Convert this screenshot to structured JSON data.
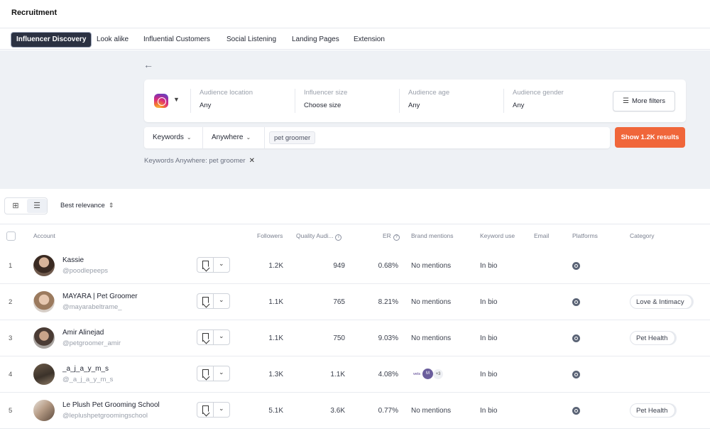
{
  "app": {
    "title": "Recruitment"
  },
  "tabs": [
    {
      "label": "Influencer Discovery",
      "active": true
    },
    {
      "label": "Look alike"
    },
    {
      "label": "Influential Customers"
    },
    {
      "label": "Social Listening"
    },
    {
      "label": "Landing Pages"
    },
    {
      "label": "Extension"
    }
  ],
  "search": {
    "platform_icon": "instagram-icon",
    "filters": [
      {
        "label": "Audience location",
        "value": "Any"
      },
      {
        "label": "Influencer size",
        "value": "Choose size"
      },
      {
        "label": "Audience age",
        "value": "Any"
      },
      {
        "label": "Audience gender",
        "value": "Any"
      }
    ],
    "more_filters_label": "More filters",
    "keyword_type": "Keywords",
    "keyword_scope": "Anywhere",
    "keyword_chip": "pet groomer",
    "show_results_label": "Show 1.2K results",
    "applied_filter": "Keywords Anywhere: pet groomer",
    "accent_color": "#f0663a"
  },
  "toolbar": {
    "sort_label": "Best relevance"
  },
  "table": {
    "columns": {
      "account": "Account",
      "followers": "Followers",
      "quality": "Quality Audi...",
      "er": "ER",
      "brand_mentions": "Brand mentions",
      "keyword_use": "Keyword use",
      "email": "Email",
      "platforms": "Platforms",
      "category": "Category"
    },
    "rows": [
      {
        "rank": "1",
        "name": "Kassie",
        "handle": "@poodlepeeps",
        "followers": "1.2K",
        "quality": "949",
        "er": "0.68%",
        "mentions": "No mentions",
        "keyword_use": "In bio",
        "category": ""
      },
      {
        "rank": "2",
        "name": "MAYARA | Pet Groomer",
        "handle": "@mayarabeltrame_",
        "followers": "1.1K",
        "quality": "765",
        "er": "8.21%",
        "mentions": "No mentions",
        "keyword_use": "In bio",
        "category": "Love & Intimacy"
      },
      {
        "rank": "3",
        "name": "Amir Alinejad",
        "handle": "@petgroomer_amir",
        "followers": "1.1K",
        "quality": "750",
        "er": "9.03%",
        "mentions": "No mentions",
        "keyword_use": "In bio",
        "category": "Pet Health"
      },
      {
        "rank": "4",
        "name": "_a_j_a_y_m_s",
        "handle": "@_a_j_a_y_m_s",
        "followers": "1.3K",
        "quality": "1.1K",
        "er": "4.08%",
        "mentions": "",
        "brand_more": "+3",
        "keyword_use": "In bio",
        "category": ""
      },
      {
        "rank": "5",
        "name": "Le Plush Pet Grooming School",
        "handle": "@leplushpetgroomingschool",
        "followers": "5.1K",
        "quality": "3.6K",
        "er": "0.77%",
        "mentions": "No mentions",
        "keyword_use": "In bio",
        "category": "Pet Health"
      }
    ]
  }
}
